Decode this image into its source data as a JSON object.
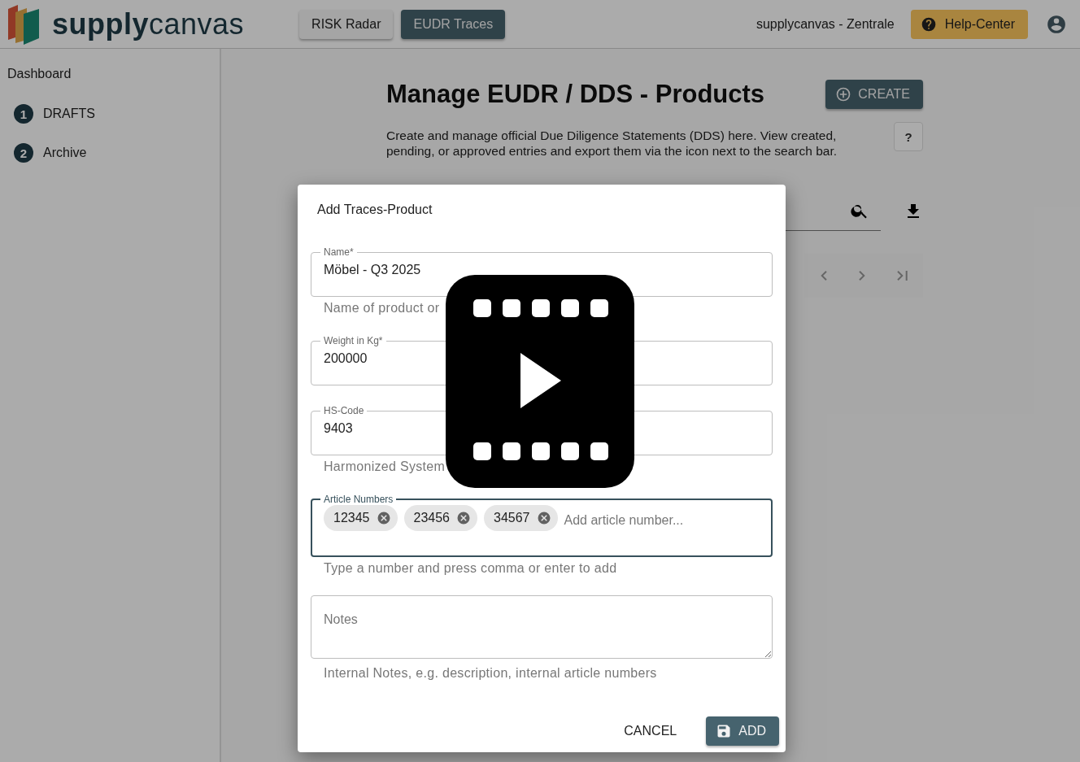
{
  "header": {
    "logo": "**supply**canvas",
    "nav": [
      {
        "label": "RISK Radar",
        "selected": false
      },
      {
        "label": "EUDR Traces",
        "selected": true
      }
    ],
    "organization": "supplycanvas - Zentrale",
    "help_button": "Help-Center"
  },
  "sidebar": {
    "title": "Dashboard",
    "items": [
      {
        "number": "1",
        "label": "DRAFTS"
      },
      {
        "number": "2",
        "label": "Archive"
      }
    ]
  },
  "main": {
    "title": "Manage EUDR / DDS - Products",
    "create_button": "CREATE",
    "description": "Create and manage official Due Diligence Statements (DDS) here. View created, pending, or approved entries and export them via the icon next to the search bar.",
    "help_button": "?"
  },
  "dialog": {
    "title": "Add Traces-Product",
    "fields": [
      {
        "kind": "text",
        "label": "Name*",
        "value": "Möbel - Q3 2025",
        "helper": "Name of product or",
        "focused": false
      },
      {
        "kind": "text",
        "label": "Weight in Kg*",
        "value": "200000",
        "focused": false
      },
      {
        "kind": "text",
        "label": "HS-Code",
        "value": "9403",
        "helper": "Harmonized System",
        "focused": false
      },
      {
        "kind": "chips",
        "label": "Article Numbers",
        "chips": [
          "12345",
          "23456",
          "34567"
        ],
        "placeholder": "Add article number...",
        "helper": "Type a number and press comma or enter to add",
        "focused": true
      },
      {
        "kind": "textarea",
        "placeholder": "Notes",
        "helper": "Internal Notes, e.g. description, internal article numbers"
      }
    ],
    "buttons": [
      {
        "kind": "text",
        "label": "CANCEL"
      },
      {
        "kind": "primary",
        "label": "ADD"
      }
    ]
  }
}
